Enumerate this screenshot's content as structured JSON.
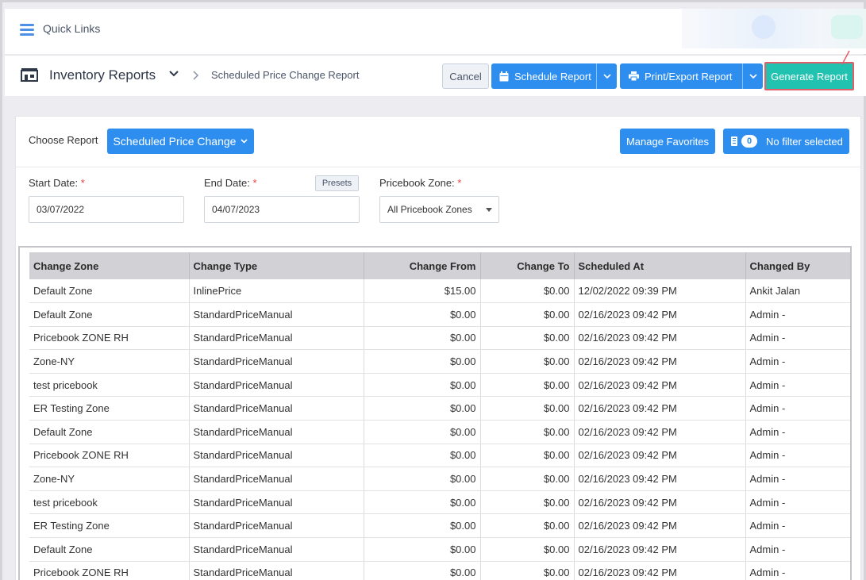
{
  "quick_links": {
    "label": "Quick Links"
  },
  "header": {
    "title": "Inventory Reports",
    "breadcrumb": "Scheduled Price Change Report",
    "cancel_label": "Cancel",
    "schedule_label": "Schedule Report",
    "print_label": "Print/Export Report",
    "generate_label": "Generate Report"
  },
  "controls": {
    "choose_label": "Choose Report",
    "report_selected": "Scheduled Price Change",
    "favorites_label": "Manage Favorites",
    "filter_count": "0",
    "filter_label": "No filter selected"
  },
  "filters": {
    "start_label": "Start Date:",
    "start_value": "03/07/2022",
    "end_label": "End Date:",
    "end_value": "04/07/2023",
    "presets_label": "Presets",
    "zone_label": "Pricebook Zone:",
    "zone_value": "All Pricebook Zones",
    "required_mark": "*"
  },
  "table": {
    "headers": [
      "Change Zone",
      "Change Type",
      "Change From",
      "Change To",
      "Scheduled At",
      "Changed By"
    ],
    "rows": [
      [
        "Default Zone",
        "InlinePrice",
        "$15.00",
        "$0.00",
        "12/02/2022 09:39 PM",
        "Ankit Jalan"
      ],
      [
        "Default Zone",
        "StandardPriceManual",
        "$0.00",
        "$0.00",
        "02/16/2023 09:42 PM",
        "Admin -"
      ],
      [
        "Pricebook ZONE RH",
        "StandardPriceManual",
        "$0.00",
        "$0.00",
        "02/16/2023 09:42 PM",
        "Admin -"
      ],
      [
        "Zone-NY",
        "StandardPriceManual",
        "$0.00",
        "$0.00",
        "02/16/2023 09:42 PM",
        "Admin -"
      ],
      [
        "test pricebook",
        "StandardPriceManual",
        "$0.00",
        "$0.00",
        "02/16/2023 09:42 PM",
        "Admin -"
      ],
      [
        "ER Testing Zone",
        "StandardPriceManual",
        "$0.00",
        "$0.00",
        "02/16/2023 09:42 PM",
        "Admin -"
      ],
      [
        "Default Zone",
        "StandardPriceManual",
        "$0.00",
        "$0.00",
        "02/16/2023 09:42 PM",
        "Admin -"
      ],
      [
        "Pricebook ZONE RH",
        "StandardPriceManual",
        "$0.00",
        "$0.00",
        "02/16/2023 09:42 PM",
        "Admin -"
      ],
      [
        "Zone-NY",
        "StandardPriceManual",
        "$0.00",
        "$0.00",
        "02/16/2023 09:42 PM",
        "Admin -"
      ],
      [
        "test pricebook",
        "StandardPriceManual",
        "$0.00",
        "$0.00",
        "02/16/2023 09:42 PM",
        "Admin -"
      ],
      [
        "ER Testing Zone",
        "StandardPriceManual",
        "$0.00",
        "$0.00",
        "02/16/2023 09:42 PM",
        "Admin -"
      ],
      [
        "Default Zone",
        "StandardPriceManual",
        "$0.00",
        "$0.00",
        "02/16/2023 09:42 PM",
        "Admin -"
      ],
      [
        "Pricebook ZONE RH",
        "StandardPriceManual",
        "$0.00",
        "$0.00",
        "02/16/2023 09:42 PM",
        "Admin -"
      ]
    ]
  },
  "colors": {
    "primary": "#2d8ef0",
    "generate": "#22c2b0",
    "highlight": "#e35d6a",
    "required": "#e53e3e"
  }
}
